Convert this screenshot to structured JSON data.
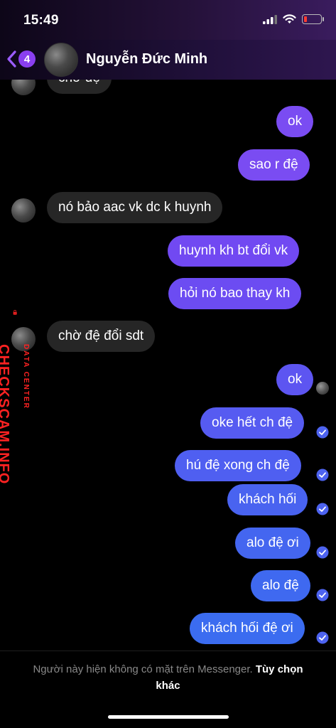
{
  "status_bar": {
    "time": "15:49"
  },
  "header": {
    "unread_count": "4",
    "contact_name": "Nguyễn Đức Minh"
  },
  "messages": [
    {
      "text": "chờ đệ",
      "sender": "them"
    },
    {
      "text": "ok",
      "sender": "me"
    },
    {
      "text": "sao r đệ",
      "sender": "me"
    },
    {
      "text": "nó bảo aac vk dc k huynh",
      "sender": "them"
    },
    {
      "text": "huynh kh bt đổi vk",
      "sender": "me"
    },
    {
      "text": "hỏi nó bao thay kh",
      "sender": "me"
    },
    {
      "text": "chờ đệ đổi sdt",
      "sender": "them"
    },
    {
      "text": "ok",
      "sender": "me",
      "status": "seen"
    },
    {
      "text": "oke hết ch đệ",
      "sender": "me",
      "status": "sent"
    },
    {
      "text": "hú đệ xong ch đệ",
      "sender": "me",
      "status": "sent"
    },
    {
      "text": "khách hối",
      "sender": "me",
      "status": "sent"
    },
    {
      "text": "alo đệ ơi",
      "sender": "me",
      "status": "sent"
    },
    {
      "text": "alo đệ",
      "sender": "me",
      "status": "sent"
    },
    {
      "text": "khách hối đệ ơi",
      "sender": "me",
      "status": "sent"
    }
  ],
  "watermark": {
    "main": "CHECKSCAM.INFO",
    "sub": "DATA CENTER"
  },
  "footer": {
    "note": "Người này hiện không có mặt trên Messenger.",
    "option": "Tùy chọn khác"
  },
  "colors": {
    "outgoing_top": "#7a4cf2",
    "outgoing_bottom": "#3d6cf0",
    "incoming": "#262626",
    "accent": "#8a3ff0",
    "watermark": "#ff2222"
  },
  "icons": [
    "signal-icon",
    "wifi-icon",
    "battery-icon",
    "back-chevron-icon",
    "check-circle-icon",
    "padlock-icon"
  ]
}
